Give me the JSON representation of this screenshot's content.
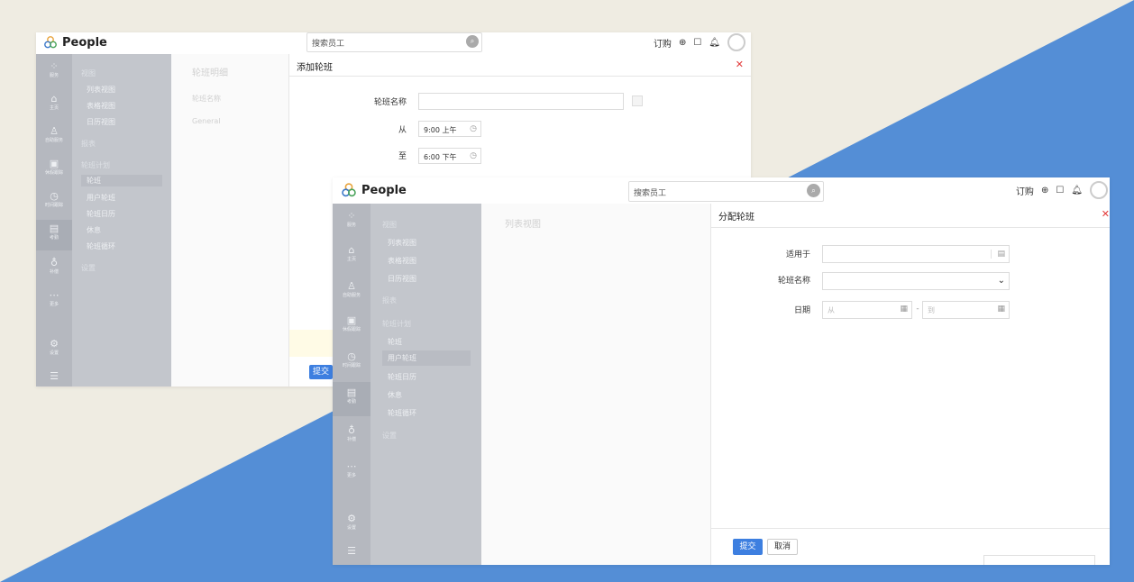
{
  "colors": {
    "background": "#efece2",
    "triangle": "#548ed6",
    "primary": "#3d7fe0",
    "close": "#e23a3a"
  },
  "win1": {
    "app_name": "People",
    "search_placeholder": "搜索员工",
    "subscribe": "订购",
    "rail": [
      {
        "icon": "grid-icon",
        "label": "服务"
      },
      {
        "icon": "home-icon",
        "label": "主页"
      },
      {
        "icon": "person-icon",
        "label": "自助服务"
      },
      {
        "icon": "calendar-icon",
        "label": "休假跟踪"
      },
      {
        "icon": "clock-icon",
        "label": "时间跟踪"
      },
      {
        "icon": "attendance-icon",
        "label": "考勤"
      },
      {
        "icon": "money-icon",
        "label": "补偿"
      },
      {
        "icon": "more-icon",
        "label": "更多"
      },
      {
        "icon": "gear-icon",
        "label": "设置"
      }
    ],
    "submenu": [
      "视图",
      "列表视图",
      "表格视图",
      "日历视图",
      "报表",
      "轮班计划",
      "轮班",
      "用户轮班",
      "轮班日历",
      "休息",
      "轮班循环",
      "设置"
    ],
    "content_title": "轮班明细",
    "content_column": "轮班名称",
    "content_row": "General",
    "dialog": {
      "title": "添加轮班",
      "fields": [
        {
          "label": "轮班名称",
          "value": ""
        },
        {
          "label": "从",
          "value": "9:00 上午"
        },
        {
          "label": "至",
          "value": "6:00 下午"
        }
      ],
      "submit": "提交"
    }
  },
  "win2": {
    "app_name": "People",
    "search_placeholder": "搜索员工",
    "subscribe": "订购",
    "rail": [
      {
        "icon": "grid-icon",
        "label": "服务"
      },
      {
        "icon": "home-icon",
        "label": "主页"
      },
      {
        "icon": "person-icon",
        "label": "自助服务"
      },
      {
        "icon": "calendar-icon",
        "label": "休假跟踪"
      },
      {
        "icon": "clock-icon",
        "label": "时间跟踪"
      },
      {
        "icon": "attendance-icon",
        "label": "考勤"
      },
      {
        "icon": "money-icon",
        "label": "补偿"
      },
      {
        "icon": "more-icon",
        "label": "更多"
      },
      {
        "icon": "gear-icon",
        "label": "设置"
      }
    ],
    "submenu": [
      "视图",
      "列表视图",
      "表格视图",
      "日历视图",
      "报表",
      "轮班计划",
      "轮班",
      "用户轮班",
      "轮班日历",
      "休息",
      "轮班循环",
      "设置"
    ],
    "content_title": "列表视图",
    "dialog": {
      "title": "分配轮班",
      "applies_label": "适用于",
      "shift_label": "轮班名称",
      "date_label": "日期",
      "from_placeholder": "从",
      "to_placeholder": "到",
      "dash": "-",
      "submit": "提交",
      "cancel": "取消"
    }
  }
}
